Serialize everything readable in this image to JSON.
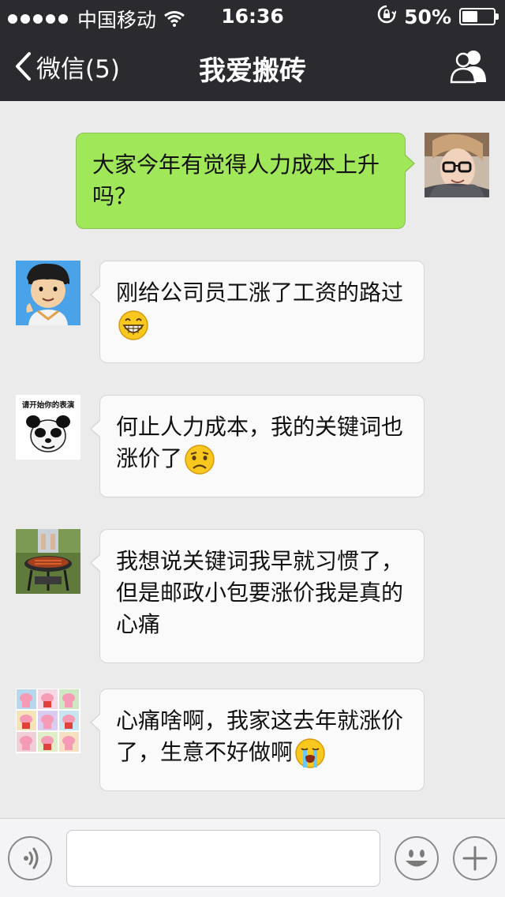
{
  "status_bar": {
    "carrier": "中国移动",
    "time": "16:36",
    "battery_percent": "50%",
    "battery_level": 0.5,
    "signal_bars": 5
  },
  "nav": {
    "back_label": "微信(5)",
    "title": "我爱搬砖",
    "back_icon": "chevron-left-icon",
    "contacts_icon": "group-contacts-icon"
  },
  "messages": [
    {
      "direction": "outgoing",
      "avatar": "avatar-glasses-scarf",
      "lines": [
        "大家今年有觉得人力成本上升",
        "吗？"
      ],
      "emoji": null
    },
    {
      "direction": "incoming",
      "avatar": "avatar-cartoon-boy",
      "lines": [
        "刚给公司员工涨了工资的路过",
        ""
      ],
      "emoji": "grinning-emoji"
    },
    {
      "direction": "incoming",
      "avatar": "avatar-panda-meme",
      "avatar_caption": "请开始你的表演",
      "lines": [
        "何止人力成本，我的关键词也",
        "涨价了"
      ],
      "emoji": "frowning-emoji"
    },
    {
      "direction": "incoming",
      "avatar": "avatar-bbq-photo",
      "lines": [
        "我想说关键词我早就习惯了，",
        "但是邮政小包要涨价我是真的",
        "心痛"
      ],
      "emoji": null
    },
    {
      "direction": "incoming",
      "avatar": "avatar-peppa-pig-grid",
      "lines": [
        "心痛啥啊，我家这去年就涨价",
        "了，生意不好做啊"
      ],
      "emoji": "crying-emoji"
    }
  ],
  "input_bar": {
    "voice_icon": "voice-icon",
    "emoji_icon": "smiley-icon",
    "plus_icon": "plus-icon",
    "text_value": ""
  },
  "colors": {
    "nav_bg": "#2b2b2f",
    "chat_bg": "#ebebeb",
    "outgoing_bubble": "#a0e75a",
    "incoming_bubble": "#fafafa"
  }
}
